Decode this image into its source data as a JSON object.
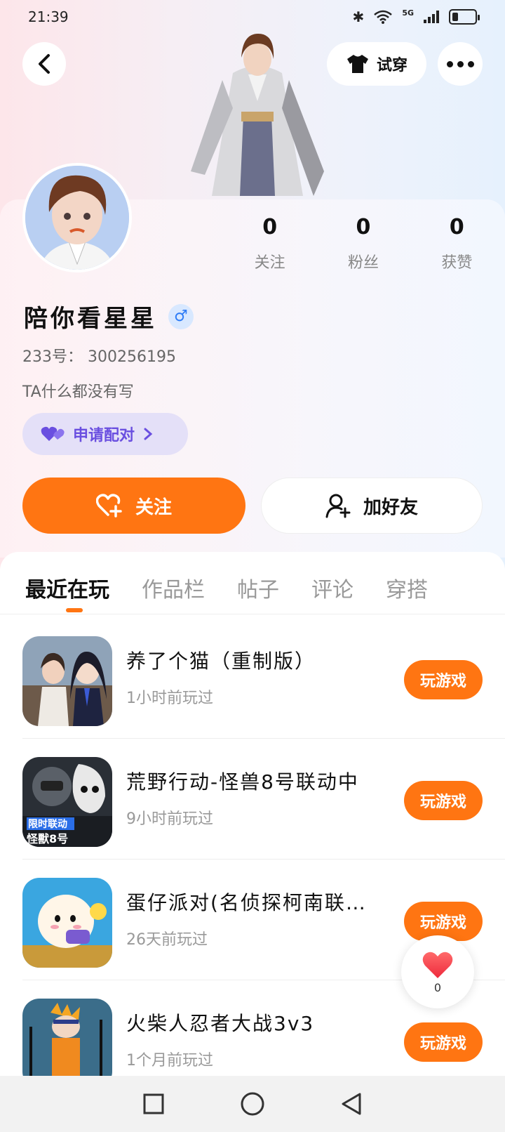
{
  "status_bar": {
    "time": "21:39",
    "network": "5G"
  },
  "header": {
    "try_on_label": "试穿"
  },
  "profile": {
    "stats": [
      {
        "value": "0",
        "label": "关注"
      },
      {
        "value": "0",
        "label": "粉丝"
      },
      {
        "value": "0",
        "label": "获赞"
      }
    ],
    "nickname": "陪你看星星",
    "gender_symbol": "♂",
    "uid_text": "233号： 300256195",
    "bio": "TA什么都没有写",
    "match_label": "申请配对",
    "follow_label": "关注",
    "add_friend_label": "加好友"
  },
  "tabs": [
    {
      "label": "最近在玩",
      "active": true
    },
    {
      "label": "作品栏",
      "active": false
    },
    {
      "label": "帖子",
      "active": false
    },
    {
      "label": "评论",
      "active": false
    },
    {
      "label": "穿搭",
      "active": false
    }
  ],
  "games": [
    {
      "name": "养了个猫（重制版）",
      "time": "1小时前玩过",
      "button": "玩游戏"
    },
    {
      "name": "荒野行动-怪兽8号联动中",
      "time": "9小时前玩过",
      "button": "玩游戏",
      "icon_text_1": "限时联动",
      "icon_text_2": "怪獸8号"
    },
    {
      "name": "蛋仔派对(名侦探柯南联…",
      "time": "26天前玩过",
      "button": "玩游戏"
    },
    {
      "name": "火柴人忍者大战3v3",
      "time": "1个月前玩过",
      "button": "玩游戏"
    }
  ],
  "like_fab": {
    "count": "0"
  },
  "colors": {
    "accent": "#ff7512",
    "match_purple": "#6a4fe0",
    "gender_blue": "#2e7cf6"
  }
}
